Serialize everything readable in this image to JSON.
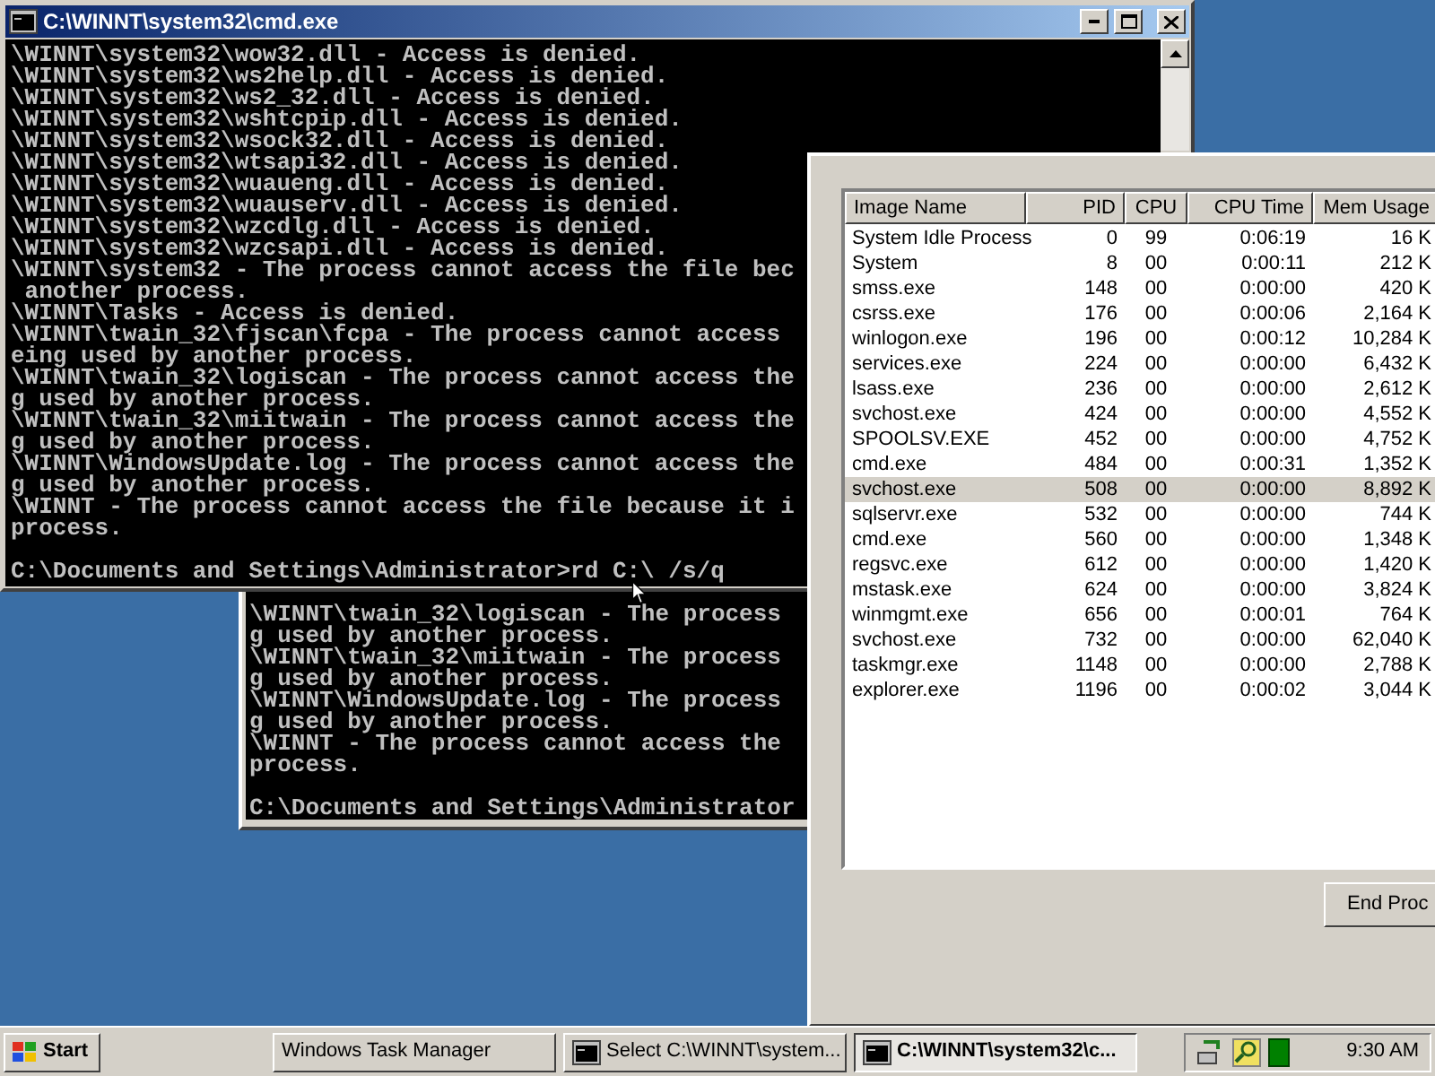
{
  "front_console": {
    "title": "C:\\WINNT\\system32\\cmd.exe",
    "active": true,
    "lines": [
      "\\WINNT\\system32\\wow32.dll - Access is denied.",
      "\\WINNT\\system32\\ws2help.dll - Access is denied.",
      "\\WINNT\\system32\\ws2_32.dll - Access is denied.",
      "\\WINNT\\system32\\wshtcpip.dll - Access is denied.",
      "\\WINNT\\system32\\wsock32.dll - Access is denied.",
      "\\WINNT\\system32\\wtsapi32.dll - Access is denied.",
      "\\WINNT\\system32\\wuaueng.dll - Access is denied.",
      "\\WINNT\\system32\\wuauserv.dll - Access is denied.",
      "\\WINNT\\system32\\wzcdlg.dll - Access is denied.",
      "\\WINNT\\system32\\wzcsapi.dll - Access is denied.",
      "\\WINNT\\system32 - The process cannot access the file bec",
      " another process.",
      "\\WINNT\\Tasks - Access is denied.",
      "\\WINNT\\twain_32\\fjscan\\fcpa - The process cannot access",
      "eing used by another process.",
      "\\WINNT\\twain_32\\logiscan - The process cannot access the",
      "g used by another process.",
      "\\WINNT\\twain_32\\miitwain - The process cannot access the",
      "g used by another process.",
      "\\WINNT\\WindowsUpdate.log - The process cannot access the",
      "g used by another process.",
      "\\WINNT - The process cannot access the file because it i",
      "process."
    ],
    "prompt": "C:\\Documents and Settings\\Administrator>rd C:\\ /s/q"
  },
  "back_console": {
    "lines": [
      "\\WINNT\\twain_32\\logiscan - The process",
      "g used by another process.",
      "\\WINNT\\twain_32\\miitwain - The process",
      "g used by another process.",
      "\\WINNT\\WindowsUpdate.log - The process",
      "g used by another process.",
      "\\WINNT - The process cannot access the",
      "process."
    ],
    "prompt": "C:\\Documents and Settings\\Administrator"
  },
  "task_manager": {
    "columns": [
      "Image Name",
      "PID",
      "CPU",
      "CPU Time",
      "Mem Usage"
    ],
    "rows": [
      {
        "name": "System Idle Process",
        "pid": "0",
        "cpu": "99",
        "cpu_time": "0:06:19",
        "mem": "16 K",
        "selected": false
      },
      {
        "name": "System",
        "pid": "8",
        "cpu": "00",
        "cpu_time": "0:00:11",
        "mem": "212 K",
        "selected": false
      },
      {
        "name": "smss.exe",
        "pid": "148",
        "cpu": "00",
        "cpu_time": "0:00:00",
        "mem": "420 K",
        "selected": false
      },
      {
        "name": "csrss.exe",
        "pid": "176",
        "cpu": "00",
        "cpu_time": "0:00:06",
        "mem": "2,164 K",
        "selected": false
      },
      {
        "name": "winlogon.exe",
        "pid": "196",
        "cpu": "00",
        "cpu_time": "0:00:12",
        "mem": "10,284 K",
        "selected": false
      },
      {
        "name": "services.exe",
        "pid": "224",
        "cpu": "00",
        "cpu_time": "0:00:00",
        "mem": "6,432 K",
        "selected": false
      },
      {
        "name": "lsass.exe",
        "pid": "236",
        "cpu": "00",
        "cpu_time": "0:00:00",
        "mem": "2,612 K",
        "selected": false
      },
      {
        "name": "svchost.exe",
        "pid": "424",
        "cpu": "00",
        "cpu_time": "0:00:00",
        "mem": "4,552 K",
        "selected": false
      },
      {
        "name": "SPOOLSV.EXE",
        "pid": "452",
        "cpu": "00",
        "cpu_time": "0:00:00",
        "mem": "4,752 K",
        "selected": false
      },
      {
        "name": "cmd.exe",
        "pid": "484",
        "cpu": "00",
        "cpu_time": "0:00:31",
        "mem": "1,352 K",
        "selected": false
      },
      {
        "name": "svchost.exe",
        "pid": "508",
        "cpu": "00",
        "cpu_time": "0:00:00",
        "mem": "8,892 K",
        "selected": true
      },
      {
        "name": "sqlservr.exe",
        "pid": "532",
        "cpu": "00",
        "cpu_time": "0:00:00",
        "mem": "744 K",
        "selected": false
      },
      {
        "name": "cmd.exe",
        "pid": "560",
        "cpu": "00",
        "cpu_time": "0:00:00",
        "mem": "1,348 K",
        "selected": false
      },
      {
        "name": "regsvc.exe",
        "pid": "612",
        "cpu": "00",
        "cpu_time": "0:00:00",
        "mem": "1,420 K",
        "selected": false
      },
      {
        "name": "mstask.exe",
        "pid": "624",
        "cpu": "00",
        "cpu_time": "0:00:00",
        "mem": "3,824 K",
        "selected": false
      },
      {
        "name": "winmgmt.exe",
        "pid": "656",
        "cpu": "00",
        "cpu_time": "0:00:01",
        "mem": "764 K",
        "selected": false
      },
      {
        "name": "svchost.exe",
        "pid": "732",
        "cpu": "00",
        "cpu_time": "0:00:00",
        "mem": "62,040 K",
        "selected": false
      },
      {
        "name": "taskmgr.exe",
        "pid": "1148",
        "cpu": "00",
        "cpu_time": "0:00:00",
        "mem": "2,788 K",
        "selected": false
      },
      {
        "name": "explorer.exe",
        "pid": "1196",
        "cpu": "00",
        "cpu_time": "0:00:02",
        "mem": "3,044 K",
        "selected": false
      }
    ],
    "end_button": "End Proc"
  },
  "taskbar": {
    "start": "Start",
    "buttons": [
      {
        "label": "Windows Task Manager",
        "kind": "plain",
        "selected": false
      },
      {
        "label": "Select C:\\WINNT\\system...",
        "kind": "console",
        "selected": false
      },
      {
        "label": "C:\\WINNT\\system32\\c...",
        "kind": "console",
        "selected": true
      }
    ],
    "clock": "9:30 AM"
  }
}
